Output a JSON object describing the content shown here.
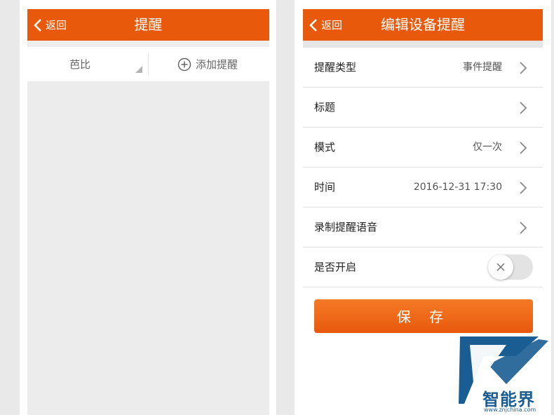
{
  "colors": {
    "accent": "#e8590c",
    "brand": "#1a5d92"
  },
  "left_screen": {
    "header": {
      "back_label": "返回",
      "title": "提醒"
    },
    "filter": {
      "device_name": "芭比",
      "add_label": "添加提醒"
    }
  },
  "right_screen": {
    "header": {
      "back_label": "返回",
      "title": "编辑设备提醒"
    },
    "rows": [
      {
        "label": "提醒类型",
        "value": "事件提醒"
      },
      {
        "label": "标题",
        "value": ""
      },
      {
        "label": "模式",
        "value": "仅一次"
      },
      {
        "label": "时间",
        "value": "2016-12-31 17:30"
      },
      {
        "label": "录制提醒语音",
        "value": ""
      },
      {
        "label": "是否开启",
        "toggle_on": false
      }
    ],
    "save_label": "保 存"
  },
  "watermark": {
    "name": "智能界",
    "url": "www.znjchina.com"
  }
}
